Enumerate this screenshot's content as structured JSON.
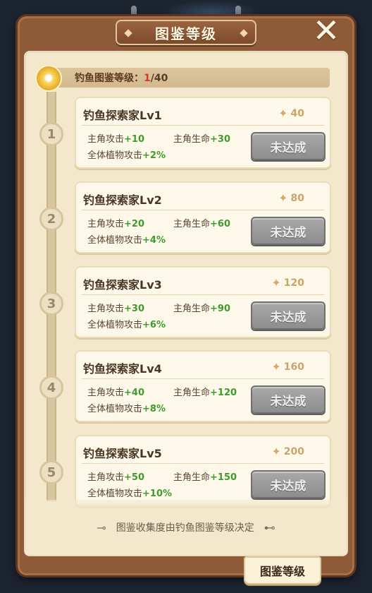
{
  "header": {
    "title": "图鉴等级",
    "close_label": "✕"
  },
  "level": {
    "label": "钓鱼图鉴等级：",
    "current": "1",
    "separator": "/",
    "max": "40"
  },
  "levels": [
    {
      "index": "1",
      "name": "钓鱼探索家Lv1",
      "requirement": "40",
      "attack_label": "主角攻击",
      "attack_value": "+10",
      "hp_label": "主角生命",
      "hp_value": "+30",
      "plant_label": "全体植物攻击",
      "plant_value": "+2%",
      "button": "未达成"
    },
    {
      "index": "2",
      "name": "钓鱼探索家Lv2",
      "requirement": "80",
      "attack_label": "主角攻击",
      "attack_value": "+20",
      "hp_label": "主角生命",
      "hp_value": "+60",
      "plant_label": "全体植物攻击",
      "plant_value": "+4%",
      "button": "未达成"
    },
    {
      "index": "3",
      "name": "钓鱼探索家Lv3",
      "requirement": "120",
      "attack_label": "主角攻击",
      "attack_value": "+30",
      "hp_label": "主角生命",
      "hp_value": "+90",
      "plant_label": "全体植物攻击",
      "plant_value": "+6%",
      "button": "未达成"
    },
    {
      "index": "4",
      "name": "钓鱼探索家Lv4",
      "requirement": "160",
      "attack_label": "主角攻击",
      "attack_value": "+40",
      "hp_label": "主角生命",
      "hp_value": "+120",
      "plant_label": "全体植物攻击",
      "plant_value": "+8%",
      "button": "未达成"
    },
    {
      "index": "5",
      "name": "钓鱼探索家Lv5",
      "requirement": "200",
      "attack_label": "主角攻击",
      "attack_value": "+50",
      "hp_label": "主角生命",
      "hp_value": "+150",
      "plant_label": "全体植物攻击",
      "plant_value": "+10%",
      "button": "未达成"
    }
  ],
  "footer": {
    "note": "图鉴收集度由钓鱼图鉴等级决定"
  },
  "tab": {
    "label": "图鉴等级"
  },
  "icons": {
    "close": "close-icon",
    "medal": "medal-icon",
    "requirement": "star-badge-icon",
    "footer_left": "bone-icon",
    "footer_right": "bone-icon"
  },
  "colors": {
    "frame": "#8f5a37",
    "panel": "#f3e8cc",
    "card": "#fdf8ea",
    "bonus_value": "#3f9b2e",
    "current_level": "#d13a2a",
    "button_disabled": "#9a9a9a"
  }
}
